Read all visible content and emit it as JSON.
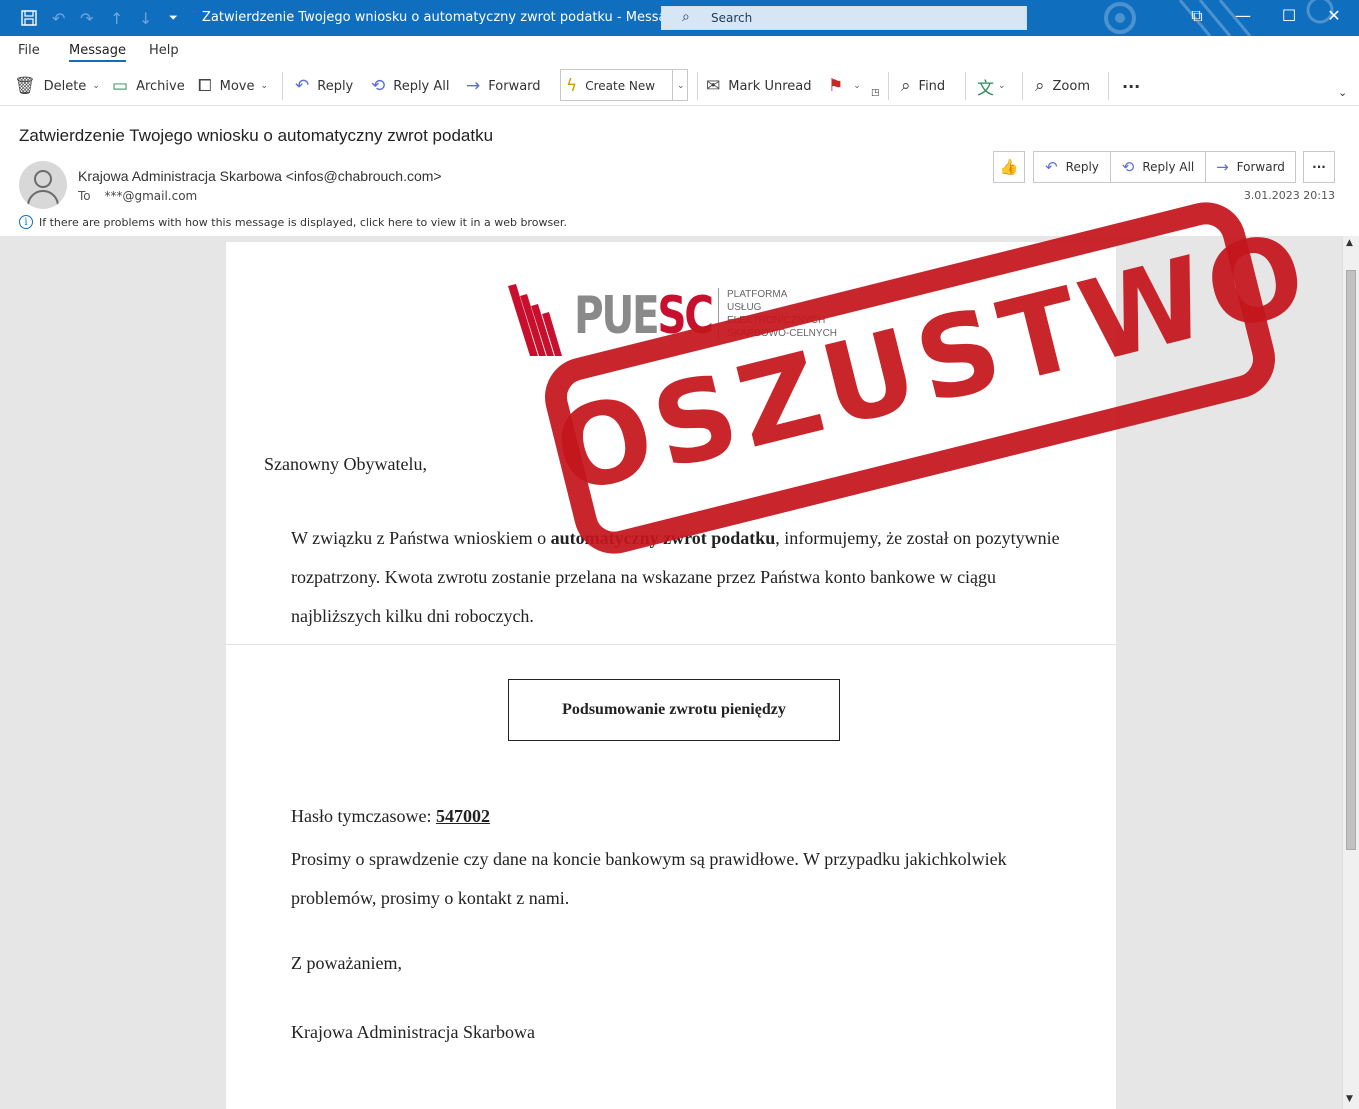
{
  "window": {
    "title": "Zatwierdzenie Twojego wniosku o automatyczny zwrot podatku  -  Message (HTML)",
    "search_placeholder": "Search"
  },
  "menu": {
    "file": "File",
    "message": "Message",
    "help": "Help"
  },
  "toolbar": {
    "delete": "Delete",
    "archive": "Archive",
    "move": "Move",
    "reply": "Reply",
    "reply_all": "Reply All",
    "forward": "Forward",
    "create_new": "Create New",
    "mark_unread": "Mark Unread",
    "find": "Find",
    "zoom": "Zoom",
    "more": "···"
  },
  "message": {
    "subject": "Zatwierdzenie Twojego wniosku o automatyczny zwrot podatku",
    "sender": "Krajowa Administracja Skarbowa <infos@chabrouch.com>",
    "to_label": "To",
    "to": "***@gmail.com",
    "info": "If there are problems with how this message is displayed, click here to view it in a web browser.",
    "date": "3.01.2023 20:13",
    "actions": {
      "reply": "Reply",
      "reply_all": "Reply All",
      "forward": "Forward",
      "more": "···"
    }
  },
  "body": {
    "logo_text_gray": "PUE",
    "logo_text_red": "SC",
    "logo_caption": [
      "PLATFORMA",
      "USŁUG",
      "ELEKTRONICZNYCH",
      "SKARBOWO-CELNYCH"
    ],
    "greeting": "Szanowny Obywatelu,",
    "para1_before": "W związku z Państwa wnioskiem o ",
    "para1_bold": "automatyczny zwrot podatku",
    "para1_after": ", informujemy, że został on pozytywnie rozpatrzony. Kwota zwrotu zostanie przelana na wskazane przez Państwa konto bankowe w ciągu najbliższych kilku dni roboczych.",
    "button": "Podsumowanie zwrotu pieniędzy",
    "password_label": "Hasło tymczasowe: ",
    "password_value": "547002",
    "para2": "Prosimy o sprawdzenie czy dane na koncie bankowym są prawidłowe. W przypadku jakichkolwiek problemów, prosimy o kontakt z nami.",
    "regards": "Z poważaniem,",
    "signoff": "Krajowa Administracja Skarbowa"
  },
  "stamp": {
    "text": "OSZUSTWO",
    "color": "#c4161c"
  },
  "colors": {
    "accent": "#106ebe",
    "logo_red": "#c8102e"
  }
}
